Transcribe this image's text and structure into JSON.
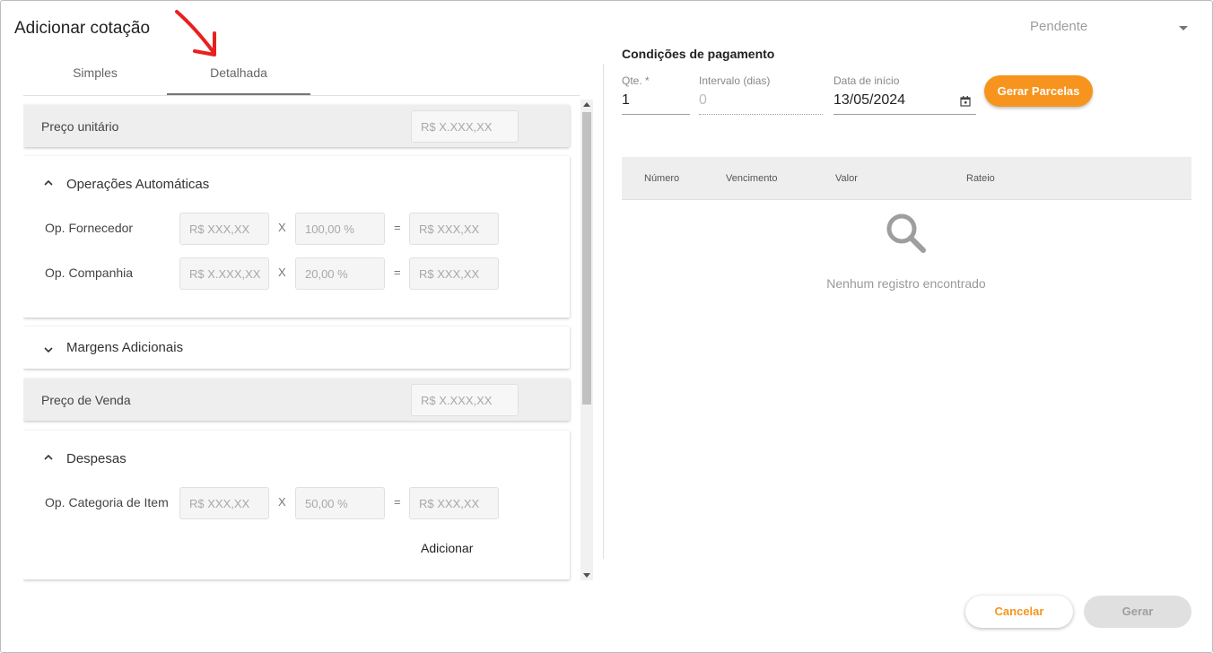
{
  "dialog": {
    "title": "Adicionar cotação",
    "status": "Pendente"
  },
  "tabs": [
    {
      "label": "Simples",
      "active": false
    },
    {
      "label": "Detalhada",
      "active": true
    }
  ],
  "left": {
    "preco_unitario": {
      "label": "Preço unitário",
      "placeholder": "R$ X.XXX,XX"
    },
    "operacoes": {
      "title": "Operações Automáticas",
      "rows": [
        {
          "label": "Op. Fornecedor",
          "a": "R$ XXX,XX",
          "x": "X",
          "b": "100,00 %",
          "eq": "=",
          "c": "R$ XXX,XX"
        },
        {
          "label": "Op. Companhia",
          "a": "R$ X.XXX,XX",
          "x": "X",
          "b": "20,00 %",
          "eq": "=",
          "c": "R$ XXX,XX"
        }
      ]
    },
    "margens": {
      "title": "Margens Adicionais"
    },
    "preco_venda": {
      "label": "Preço de Venda",
      "placeholder": "R$ X.XXX,XX"
    },
    "despesas": {
      "title": "Despesas",
      "row": {
        "label": "Op. Categoria de Item",
        "a": "R$ XXX,XX",
        "x": "X",
        "b": "50,00 %",
        "eq": "=",
        "c": "R$ XXX,XX"
      },
      "add_label": "Adicionar"
    }
  },
  "payment": {
    "title": "Condições de pagamento",
    "qty": {
      "label": "Qte. *",
      "value": "1"
    },
    "interval": {
      "label": "Intervalo (dias)",
      "value": "0"
    },
    "start": {
      "label": "Data de início",
      "value": "13/05/2024"
    },
    "generate_installments": "Gerar Parcelas",
    "columns": [
      "Número",
      "Vencimento",
      "Valor",
      "Rateio"
    ],
    "empty": "Nenhum registro encontrado"
  },
  "footer": {
    "cancel": "Cancelar",
    "generate": "Gerar"
  },
  "colors": {
    "accent": "#f7941d",
    "annotation_arrow": "#e8211d"
  },
  "icons": [
    "annotation-arrow-icon",
    "chevron-down-icon",
    "chevron-up-icon",
    "calendar-icon",
    "search-icon"
  ]
}
